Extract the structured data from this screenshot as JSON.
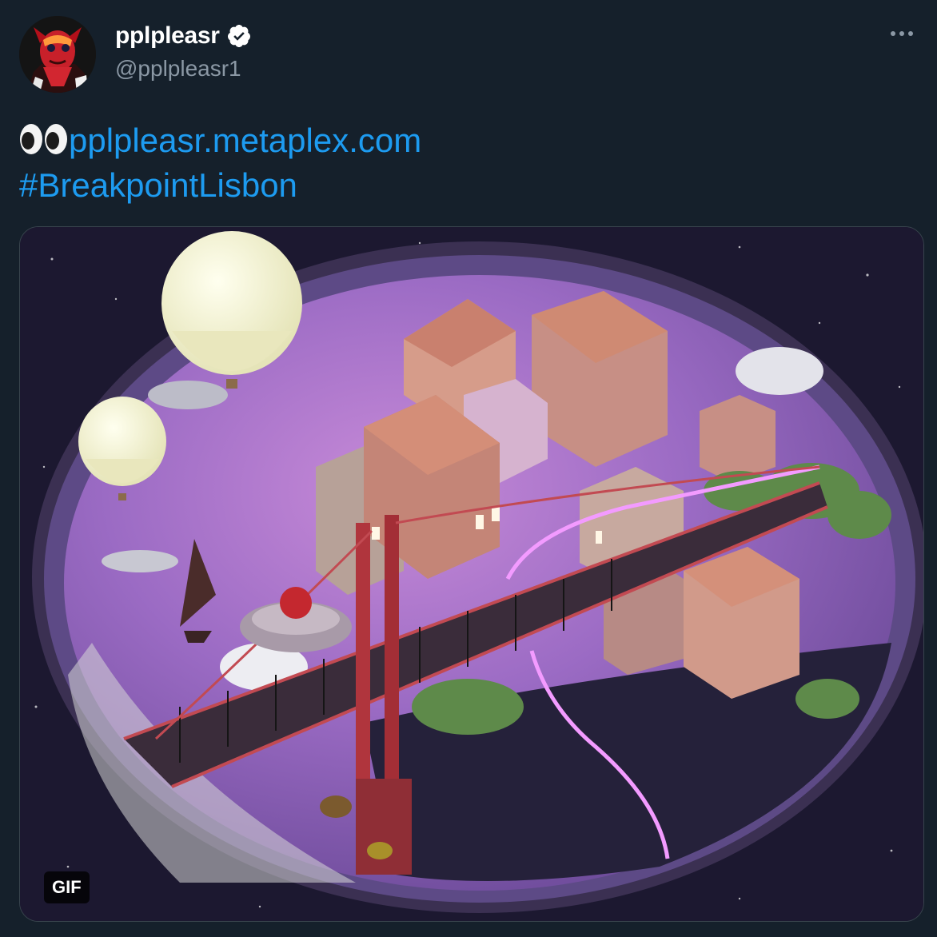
{
  "author": {
    "display_name": "pplpleasr",
    "handle": "@pplpleasr1",
    "verified": true,
    "avatar_icon": "avatar-red-character"
  },
  "tweet": {
    "eyes_emoji": "👀",
    "link_text": "pplpleasr.metaplex.com",
    "hashtag": "#BreakpointLisbon"
  },
  "media": {
    "badge": "GIF",
    "description_icon": "isometric-lisbon-illustration"
  },
  "colors": {
    "background": "#15202b",
    "link": "#1d9bf0",
    "secondary_text": "#8b98a5",
    "verified_badge": "#ffffff"
  },
  "icons": {
    "more": "more-dots-icon",
    "verified": "verified-badge-icon"
  }
}
